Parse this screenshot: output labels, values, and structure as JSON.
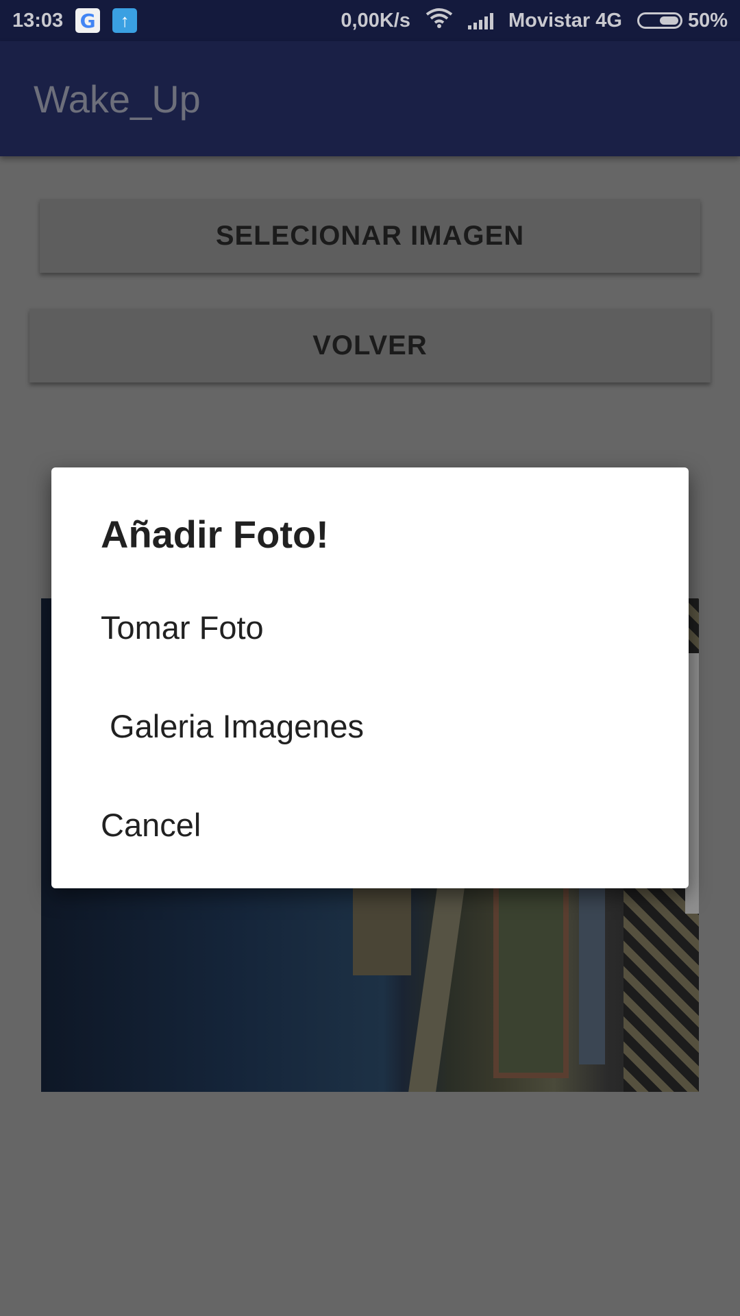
{
  "status_bar": {
    "time": "13:03",
    "google_icon": "G",
    "upload_icon": "↑",
    "speed": "0,00K/s",
    "carrier": "Movistar 4G",
    "battery_percent": "50%",
    "battery_level": 0.5
  },
  "app_bar": {
    "title": "Wake_Up"
  },
  "buttons": {
    "select_image": "SELECIONAR IMAGEN",
    "back": "VOLVER"
  },
  "dialog": {
    "title": "Añadir Foto!",
    "items": [
      {
        "label": "Tomar Foto"
      },
      {
        "label": " Galeria Imagenes"
      },
      {
        "label": "Cancel"
      }
    ]
  },
  "colors": {
    "status_bar_bg": "#141a3d",
    "app_bar_bg": "#1a2046",
    "scrim_bg": "#666666",
    "dialog_bg": "#ffffff",
    "dialog_text": "#212121"
  }
}
